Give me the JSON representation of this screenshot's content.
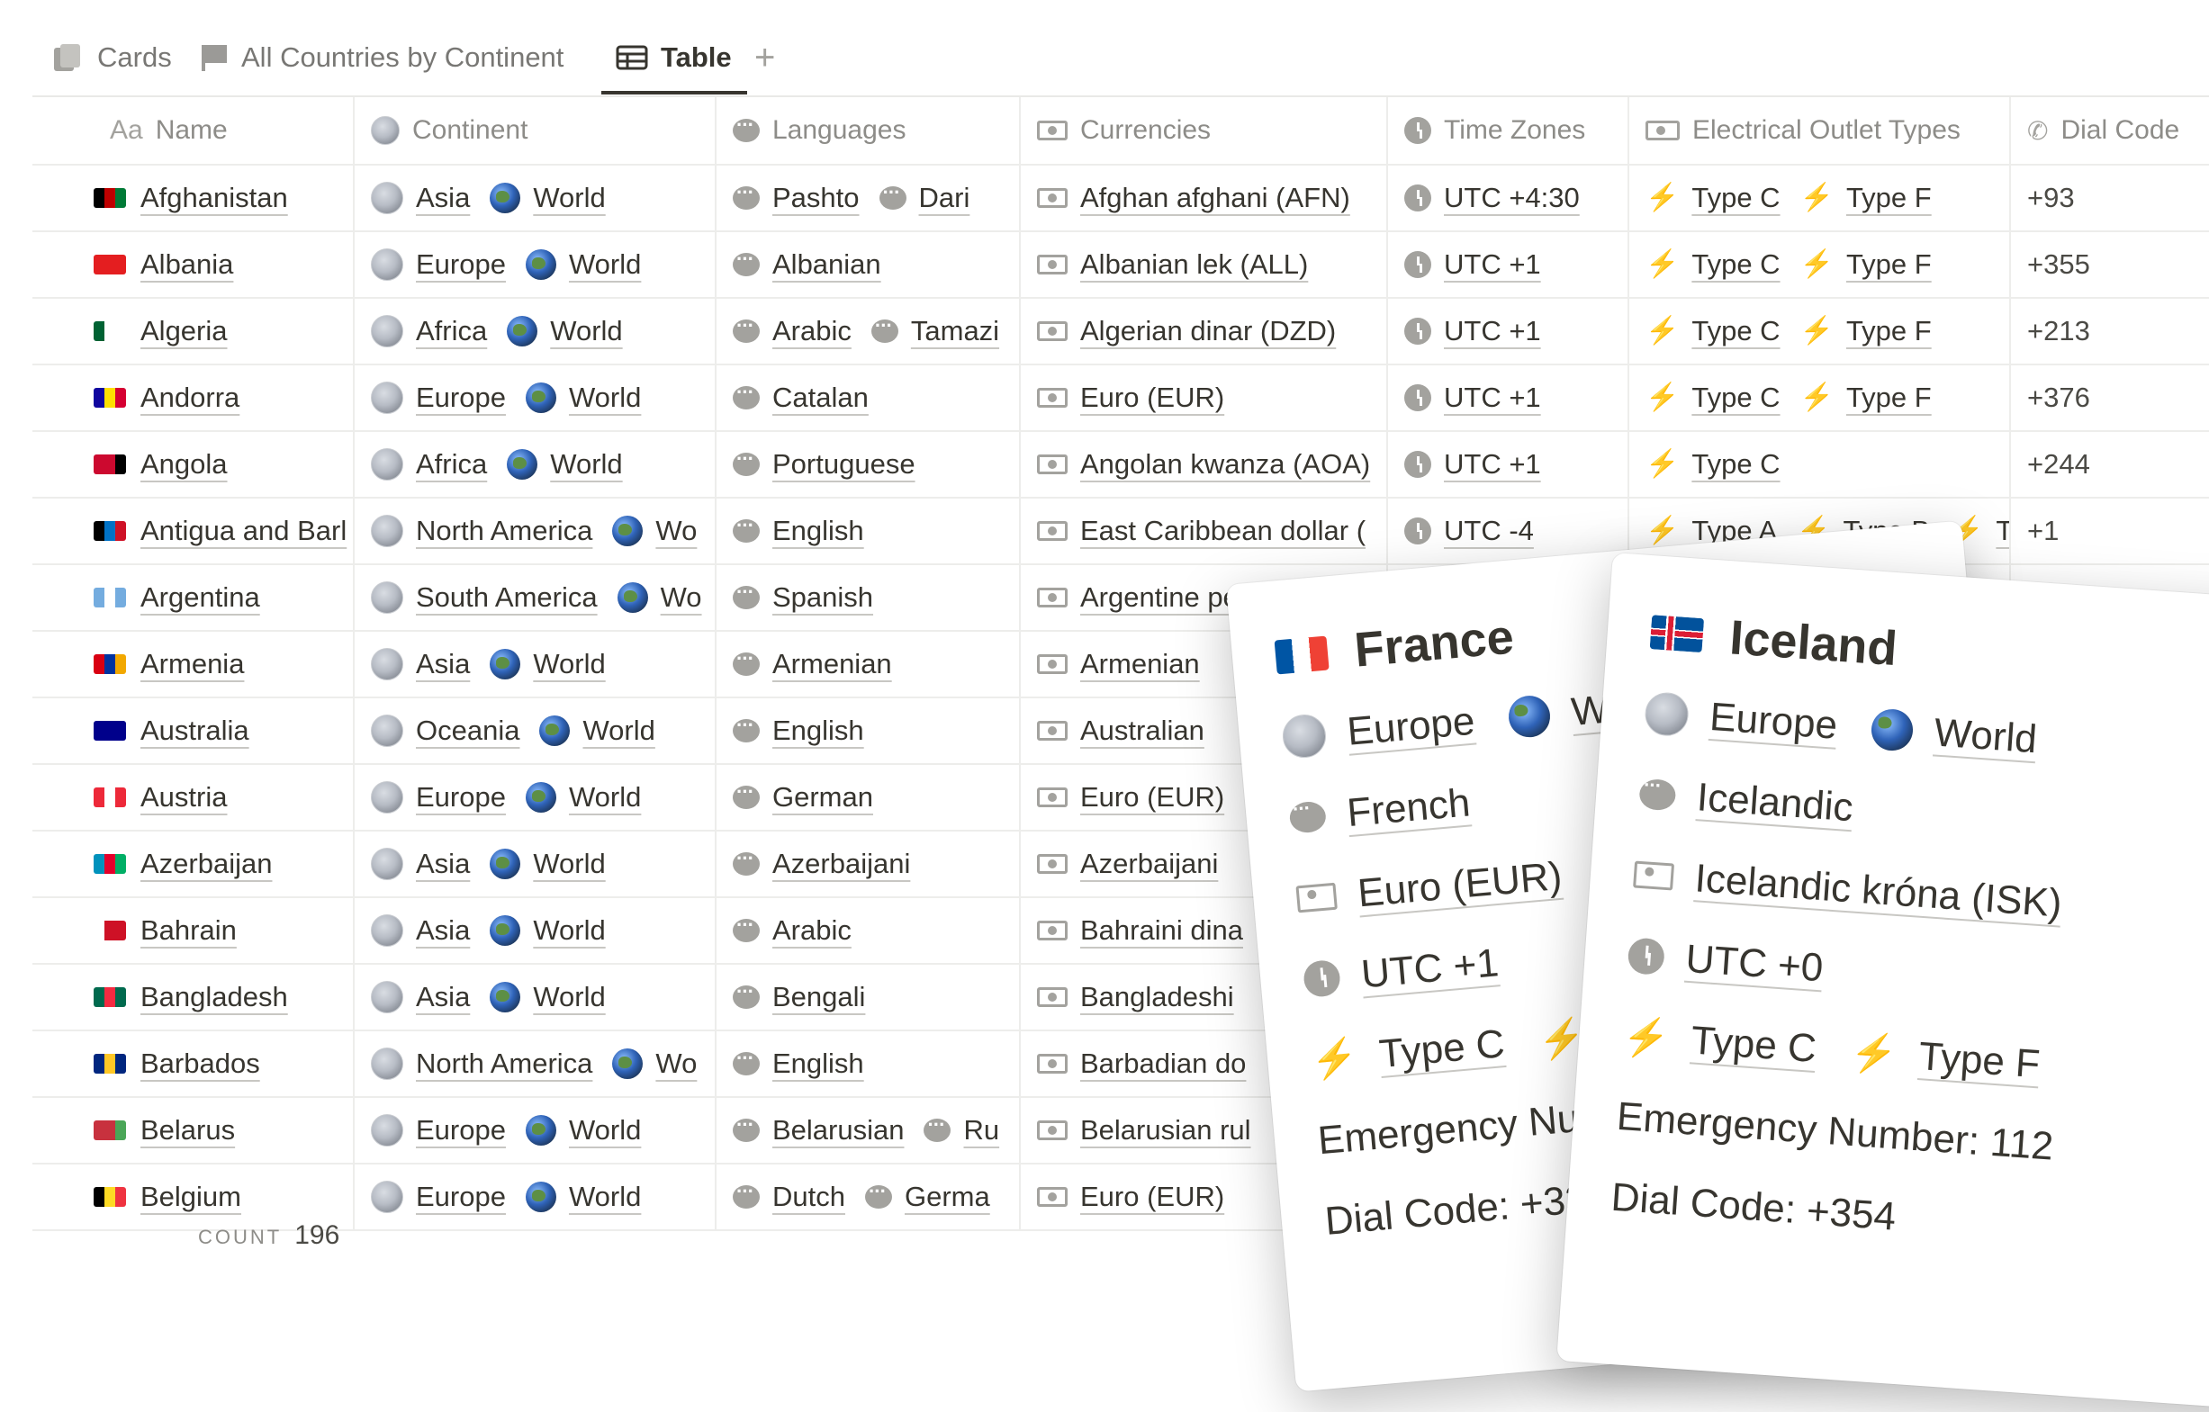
{
  "tabs": [
    {
      "label": "Cards",
      "icon": "cards-icon"
    },
    {
      "label": "All Countries by Continent",
      "icon": "board-icon"
    },
    {
      "label": "Table",
      "icon": "table-icon",
      "active": true
    }
  ],
  "add_view_label": "+",
  "columns": {
    "name": {
      "icon_text": "Aa",
      "label": "Name"
    },
    "continent": {
      "label": "Continent"
    },
    "languages": {
      "label": "Languages"
    },
    "currencies": {
      "label": "Currencies"
    },
    "time_zones": {
      "label": "Time Zones"
    },
    "outlets": {
      "label": "Electrical Outlet Types"
    },
    "dial": {
      "label": "Dial Code"
    }
  },
  "rows": [
    {
      "name": "Afghanistan",
      "flag": [
        "#000000",
        "#be0000",
        "#007a36"
      ],
      "continent": [
        "Asia",
        "World"
      ],
      "languages": [
        "Pashto",
        "Dari"
      ],
      "currency": "Afghan afghani (AFN)",
      "tz": "UTC +4:30",
      "outlets": [
        "Type C",
        "Type F"
      ],
      "dial": "+93"
    },
    {
      "name": "Albania",
      "flag": [
        "#e41e20",
        "#e41e20",
        "#e41e20"
      ],
      "continent": [
        "Europe",
        "World"
      ],
      "languages": [
        "Albanian"
      ],
      "currency": "Albanian lek (ALL)",
      "tz": "UTC +1",
      "outlets": [
        "Type C",
        "Type F"
      ],
      "dial": "+355"
    },
    {
      "name": "Algeria",
      "flag": [
        "#006233",
        "#ffffff",
        "#ffffff"
      ],
      "continent": [
        "Africa",
        "World"
      ],
      "languages": [
        "Arabic",
        "Tamazi"
      ],
      "currency": "Algerian dinar (DZD)",
      "tz": "UTC +1",
      "outlets": [
        "Type C",
        "Type F"
      ],
      "dial": "+213"
    },
    {
      "name": "Andorra",
      "flag": [
        "#10069f",
        "#fedf00",
        "#d50032"
      ],
      "continent": [
        "Europe",
        "World"
      ],
      "languages": [
        "Catalan"
      ],
      "currency": "Euro (EUR)",
      "tz": "UTC +1",
      "outlets": [
        "Type C",
        "Type F"
      ],
      "dial": "+376"
    },
    {
      "name": "Angola",
      "flag": [
        "#cc092f",
        "#cc092f",
        "#000000"
      ],
      "continent": [
        "Africa",
        "World"
      ],
      "languages": [
        "Portuguese"
      ],
      "currency": "Angolan kwanza (AOA)",
      "tz": "UTC +1",
      "outlets": [
        "Type C"
      ],
      "dial": "+244"
    },
    {
      "name": "Antigua and Barl",
      "flag": [
        "#000000",
        "#0072c6",
        "#ce1126"
      ],
      "continent": [
        "North America",
        "Wo"
      ],
      "languages": [
        "English"
      ],
      "currency": "East Caribbean dollar (",
      "tz": "UTC -4",
      "outlets": [
        "Type A",
        "Type B",
        "T"
      ],
      "dial": "+1"
    },
    {
      "name": "Argentina",
      "flag": [
        "#74acdf",
        "#ffffff",
        "#74acdf"
      ],
      "continent": [
        "South America",
        "Wo"
      ],
      "languages": [
        "Spanish"
      ],
      "currency": "Argentine peso (ARS)",
      "tz": "",
      "outlets": [],
      "dial": "+54"
    },
    {
      "name": "Armenia",
      "flag": [
        "#d90012",
        "#0033a0",
        "#f2a800"
      ],
      "continent": [
        "Asia",
        "World"
      ],
      "languages": [
        "Armenian"
      ],
      "currency": "Armenian",
      "tz": "",
      "outlets": [],
      "dial": ""
    },
    {
      "name": "Australia",
      "flag": [
        "#00008b",
        "#00008b",
        "#00008b"
      ],
      "continent": [
        "Oceania",
        "World"
      ],
      "languages": [
        "English"
      ],
      "currency": "Australian",
      "tz": "",
      "outlets": [],
      "dial": ""
    },
    {
      "name": "Austria",
      "flag": [
        "#ed2939",
        "#ffffff",
        "#ed2939"
      ],
      "continent": [
        "Europe",
        "World"
      ],
      "languages": [
        "German"
      ],
      "currency": "Euro (EUR)",
      "tz": "",
      "outlets": [],
      "dial": ""
    },
    {
      "name": "Azerbaijan",
      "flag": [
        "#0092bc",
        "#e4002b",
        "#00af66"
      ],
      "continent": [
        "Asia",
        "World"
      ],
      "languages": [
        "Azerbaijani"
      ],
      "currency": "Azerbaijani",
      "tz": "",
      "outlets": [],
      "dial": ""
    },
    {
      "name": "Bahrain",
      "flag": [
        "#ffffff",
        "#ce1126",
        "#ce1126"
      ],
      "continent": [
        "Asia",
        "World"
      ],
      "languages": [
        "Arabic"
      ],
      "currency": "Bahraini dina",
      "tz": "",
      "outlets": [],
      "dial": ""
    },
    {
      "name": "Bangladesh",
      "flag": [
        "#006a4e",
        "#f42a41",
        "#006a4e"
      ],
      "continent": [
        "Asia",
        "World"
      ],
      "languages": [
        "Bengali"
      ],
      "currency": "Bangladeshi",
      "tz": "",
      "outlets": [],
      "dial": ""
    },
    {
      "name": "Barbados",
      "flag": [
        "#00267f",
        "#ffc726",
        "#00267f"
      ],
      "continent": [
        "North America",
        "Wo"
      ],
      "languages": [
        "English"
      ],
      "currency": "Barbadian do",
      "tz": "",
      "outlets": [],
      "dial": ""
    },
    {
      "name": "Belarus",
      "flag": [
        "#c8313e",
        "#c8313e",
        "#4aa657"
      ],
      "continent": [
        "Europe",
        "World"
      ],
      "languages": [
        "Belarusian",
        "Ru"
      ],
      "currency": "Belarusian rul",
      "tz": "",
      "outlets": [],
      "dial": ""
    },
    {
      "name": "Belgium",
      "flag": [
        "#000000",
        "#fdda24",
        "#ef3340"
      ],
      "continent": [
        "Europe",
        "World"
      ],
      "languages": [
        "Dutch",
        "Germa"
      ],
      "currency": "Euro (EUR)",
      "tz": "",
      "outlets": [],
      "dial": ""
    }
  ],
  "footer": {
    "label": "COUNT",
    "value": "196"
  },
  "cards": {
    "france": {
      "name": "France",
      "flag": [
        "#0055a4",
        "#ffffff",
        "#ef4135"
      ],
      "continent": [
        "Europe",
        "Wor"
      ],
      "language": "French",
      "currency": "Euro (EUR)",
      "tz": "UTC +1",
      "outlets": [
        "Type C",
        "T"
      ],
      "emergency": "Emergency Nu",
      "dial": "Dial Code: +33"
    },
    "iceland": {
      "name": "Iceland",
      "flag": [
        "#02529c",
        "#dc1e35",
        "#ffffff"
      ],
      "continent": [
        "Europe",
        "World"
      ],
      "language": "Icelandic",
      "currency": "Icelandic króna (ISK)",
      "tz": "UTC +0",
      "outlets": [
        "Type C",
        "Type F"
      ],
      "emergency": "Emergency Number: 112",
      "dial": "Dial Code: +354"
    }
  }
}
